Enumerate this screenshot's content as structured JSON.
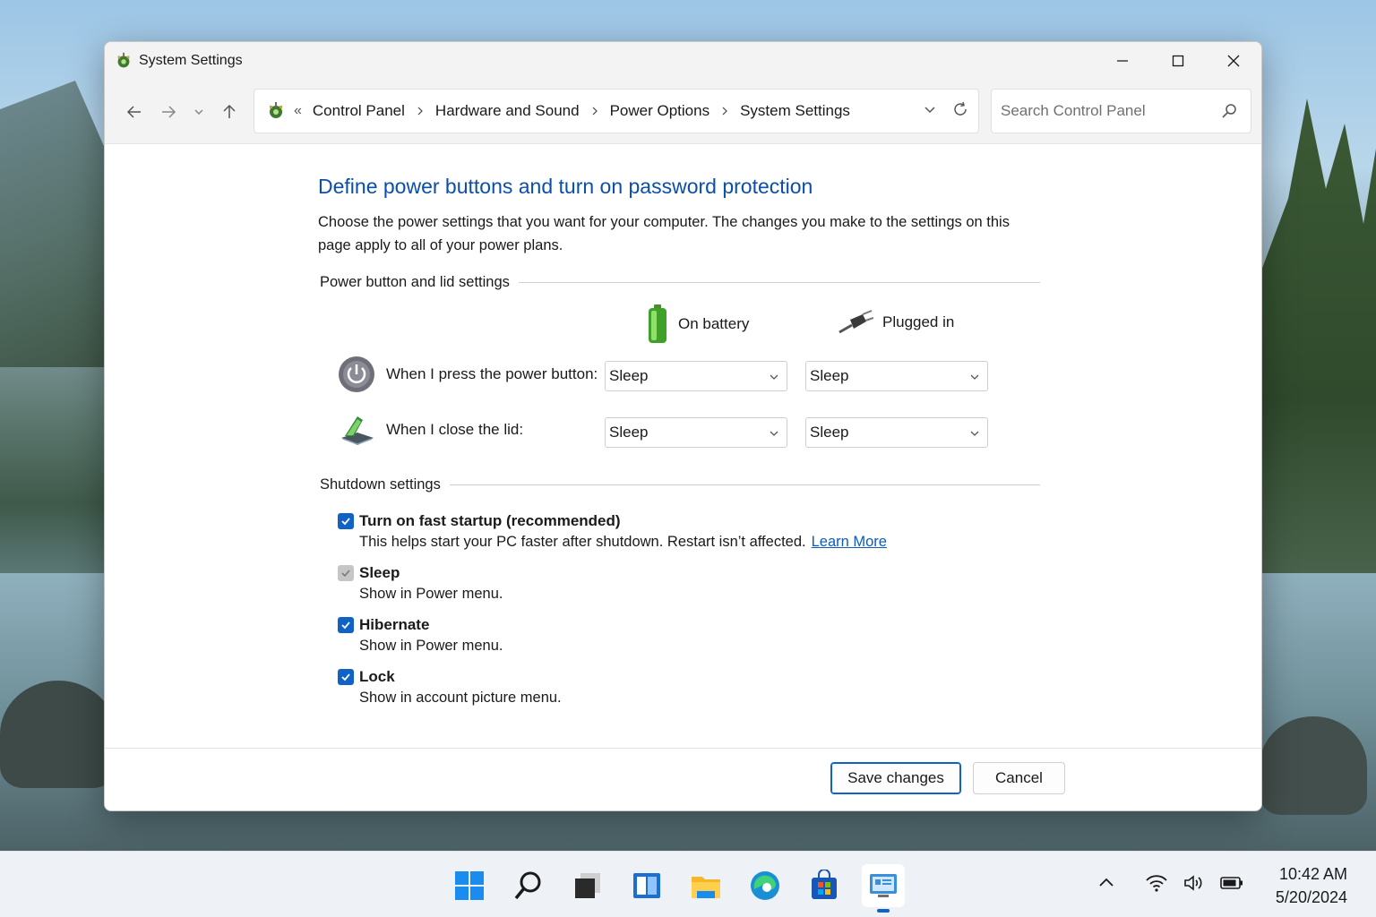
{
  "window": {
    "title": "System Settings"
  },
  "navbar": {
    "breadcrumb": [
      "Control Panel",
      "Hardware and Sound",
      "Power Options",
      "System Settings"
    ],
    "overflow_glyph": "«",
    "search_placeholder": "Search Control Panel"
  },
  "main": {
    "heading": "Define power buttons and turn on password protection",
    "description": "Choose the power settings that you want for your computer. The changes you make to the settings on this page apply to all of your power plans.",
    "power_section_label": "Power button and lid settings",
    "column_battery": "On battery",
    "column_plugged": "Plugged in",
    "rows": [
      {
        "label": "When I press the power button:",
        "battery": "Sleep",
        "plugged": "Sleep"
      },
      {
        "label": "When I close the lid:",
        "battery": "Sleep",
        "plugged": "Sleep"
      }
    ],
    "shutdown_section_label": "Shutdown settings",
    "options": [
      {
        "title": "Turn on fast startup (recommended)",
        "subtitle": "This helps start your PC faster after shutdown. Restart isn’t affected.",
        "link": "Learn More",
        "checked": true,
        "enabled": true
      },
      {
        "title": "Sleep",
        "subtitle": "Show in Power menu.",
        "checked": true,
        "enabled": false
      },
      {
        "title": "Hibernate",
        "subtitle": "Show in Power menu.",
        "checked": true,
        "enabled": true
      },
      {
        "title": "Lock",
        "subtitle": "Show in account picture menu.",
        "checked": true,
        "enabled": true
      }
    ]
  },
  "footer": {
    "save_label": "Save changes",
    "cancel_label": "Cancel"
  },
  "taskbar": {
    "apps": [
      "start-icon",
      "search-icon",
      "task-view-icon",
      "widgets-icon",
      "file-explorer-icon",
      "edge-icon",
      "store-icon",
      "control-panel-icon"
    ],
    "time": "10:42 AM",
    "date": "5/20/2024"
  },
  "colors": {
    "heading": "#0b4fa8",
    "accent": "#1062c7",
    "link": "#0b5cc0"
  }
}
